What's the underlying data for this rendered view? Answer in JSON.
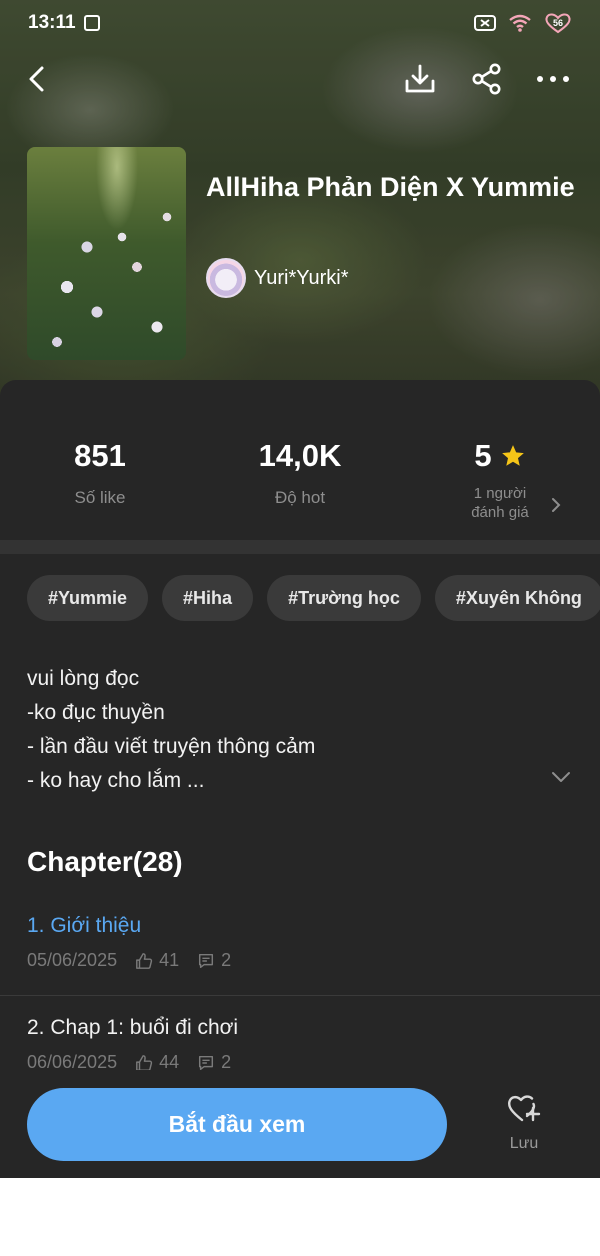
{
  "status_bar": {
    "time": "13:11",
    "battery": "56"
  },
  "book": {
    "title": "AllHiha Phản Diện X Yummie",
    "author": "Yuri*Yurki*"
  },
  "stats": {
    "likes": {
      "value": "851",
      "label": "Số like"
    },
    "hot": {
      "value": "14,0K",
      "label": "Độ hot"
    },
    "rating": {
      "value": "5",
      "label_line1": "1 người",
      "label_line2": "đánh giá"
    }
  },
  "tags": [
    "#Yummie",
    "#Hiha",
    "#Trường học",
    "#Xuyên Không"
  ],
  "description": {
    "line1": "vui lòng đọc",
    "line2": "-ko đục thuyền",
    "line3": "- lần đầu viết truyện thông cảm",
    "line4": "- ko hay cho lắm ..."
  },
  "chapters": {
    "heading": "Chapter(28)",
    "items": [
      {
        "title": "1. Giới thiệu",
        "date": "05/06/2025",
        "likes": "41",
        "comments": "2"
      },
      {
        "title": "2. Chap 1: buổi đi chơi",
        "date": "06/06/2025",
        "likes": "44",
        "comments": "2"
      }
    ]
  },
  "actions": {
    "start_label": "Bắt đầu xem",
    "save_label": "Lưu"
  },
  "colors": {
    "accent": "#5aa8f2",
    "link": "#5aa8f2",
    "star": "#f5c518",
    "sheet_bg": "#262626"
  },
  "icons": [
    "back-icon",
    "download-icon",
    "share-icon",
    "more-icon",
    "star-icon",
    "chevron-right-icon",
    "chevron-down-icon",
    "thumbs-up-icon",
    "comment-icon",
    "heart-plus-icon"
  ]
}
